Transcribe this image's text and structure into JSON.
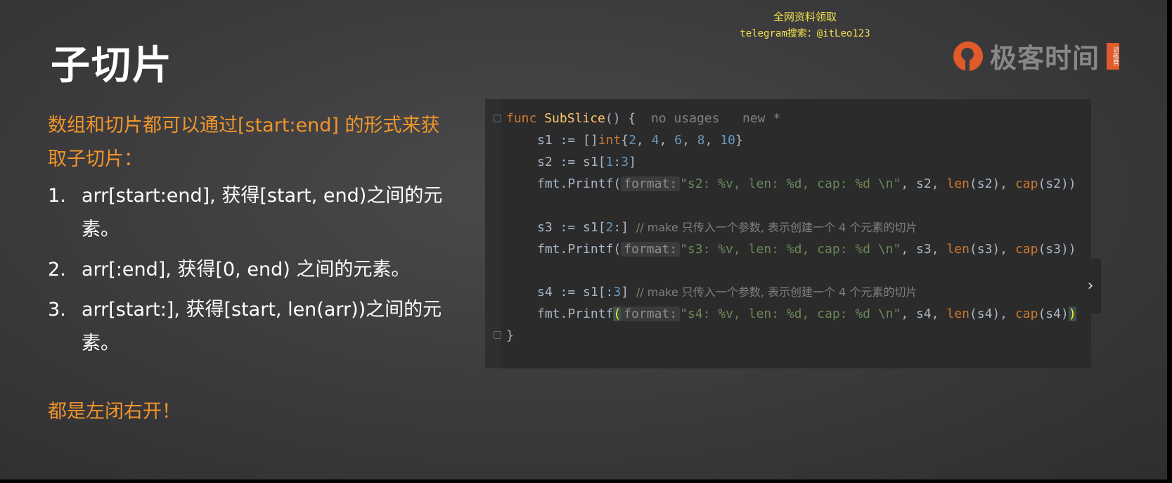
{
  "slide": {
    "title": "子切片",
    "watermark": {
      "line1": "全网资料领取",
      "line2": "telegram搜索：@itLeo123"
    },
    "logo": {
      "text": "极客时间",
      "badge": "训练营"
    },
    "intro": "数组和切片都可以通过[start:end] 的形式来获取子切片：",
    "list": [
      {
        "num": "1.",
        "text": "arr[start:end], 获得[start, end)之间的元素。"
      },
      {
        "num": "2.",
        "text": "arr[:end], 获得[0, end) 之间的元素。"
      },
      {
        "num": "3.",
        "text": "arr[start:], 获得[start, len(arr))之间的元素。"
      }
    ],
    "conclusion": "都是左闭右开！"
  },
  "code": {
    "l1_func": "func",
    "l1_name": "SubSlice",
    "l1_rest": "() {",
    "l1_meta": "no usages   new *",
    "l2_a": "s1 := []",
    "l2_int": "int",
    "l2_b": "{",
    "l2_nums": [
      "2",
      "4",
      "6",
      "8",
      "10"
    ],
    "l2_c": "}",
    "l3_a": "s2 := s1[",
    "l3_n1": "1",
    "l3_colon": ":",
    "l3_n2": "3",
    "l3_b": "]",
    "hint": "format:",
    "p1_a": "fmt.Printf(",
    "p1_str": "\"s2: %v, len: %d, cap: %d \\n\"",
    "p1_b": ", s2, ",
    "p1_len": "len",
    "p1_c": "(s2), ",
    "p1_cap": "cap",
    "p1_d": "(s2))",
    "l6_a": "s3 := s1[",
    "l6_n": "2",
    "l6_b": ":] ",
    "l6_cmt": "// make 只传入一个参数, 表示创建一个 4 个元素的切片",
    "p2_a": "fmt.Printf(",
    "p2_str": "\"s3: %v, len: %d, cap: %d \\n\"",
    "p2_b": ", s3, ",
    "p2_len": "len",
    "p2_c": "(s3), ",
    "p2_cap": "cap",
    "p2_d": "(s3))",
    "l9_a": "s4 := s1[:",
    "l9_n": "3",
    "l9_b": "] ",
    "l9_cmt": "// make 只传入一个参数, 表示创建一个 4 个元素的切片",
    "p3_a": "fmt.Printf",
    "p3_paren": "(",
    "p3_str": "\"s4: %v, len: %d, cap: %d \\n\"",
    "p3_b": ", s4, ",
    "p3_len": "len",
    "p3_c": "(s4), ",
    "p3_cap": "cap",
    "p3_d": "(s4)",
    "p3_end": ")",
    "close": "}"
  },
  "nav": {
    "next_icon": "chevron-right-icon",
    "next_glyph": "›"
  },
  "colors": {
    "accent_orange": "#f0952a",
    "logo_orange": "#e05a2a",
    "watermark_yellow": "#f2e24a"
  }
}
